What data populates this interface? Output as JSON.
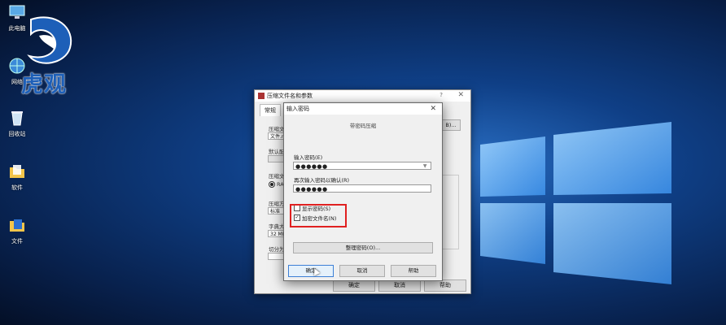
{
  "desktop": {
    "icons": [
      {
        "label": "此电脑",
        "icon": "computer-icon"
      },
      {
        "label": "网络",
        "icon": "network-icon"
      },
      {
        "label": "回收站",
        "icon": "recycle-bin-icon"
      },
      {
        "label": "软件",
        "icon": "folder-icon"
      },
      {
        "label": "文件",
        "icon": "document-icon"
      }
    ],
    "watermark": "虎观",
    "accent": "#1d5fb8"
  },
  "back_dialog": {
    "title": "压缩文件名和参数",
    "help_glyph": "?",
    "close_glyph": "✕",
    "tab": "常规",
    "labels": [
      "压缩文",
      "默认配",
      "压缩文",
      "压缩方",
      "字典大",
      "切分为"
    ],
    "fields": [
      "文件.ra",
      "标准",
      "32 MB"
    ],
    "radio_label": "RA",
    "browse_fragment": "B)...",
    "buttons": {
      "ok": "确定",
      "cancel": "取消",
      "help": "帮助"
    }
  },
  "password_dialog": {
    "title": "输入密码",
    "close_glyph": "✕",
    "heading": "带密码压缩",
    "enter_label": "输入密码(E)",
    "enter_value": "●●●●●●",
    "reenter_label": "再次输入密码以确认(R)",
    "reenter_value": "●●●●●●",
    "show_password": {
      "label": "显示密码(S)",
      "checked": false
    },
    "encrypt_names": {
      "label": "加密文件名(N)",
      "checked": true
    },
    "organize_button": "整理密码(O)...",
    "buttons": {
      "ok": "确定",
      "cancel": "取消",
      "help": "帮助"
    },
    "highlight_color": "#e02020"
  }
}
